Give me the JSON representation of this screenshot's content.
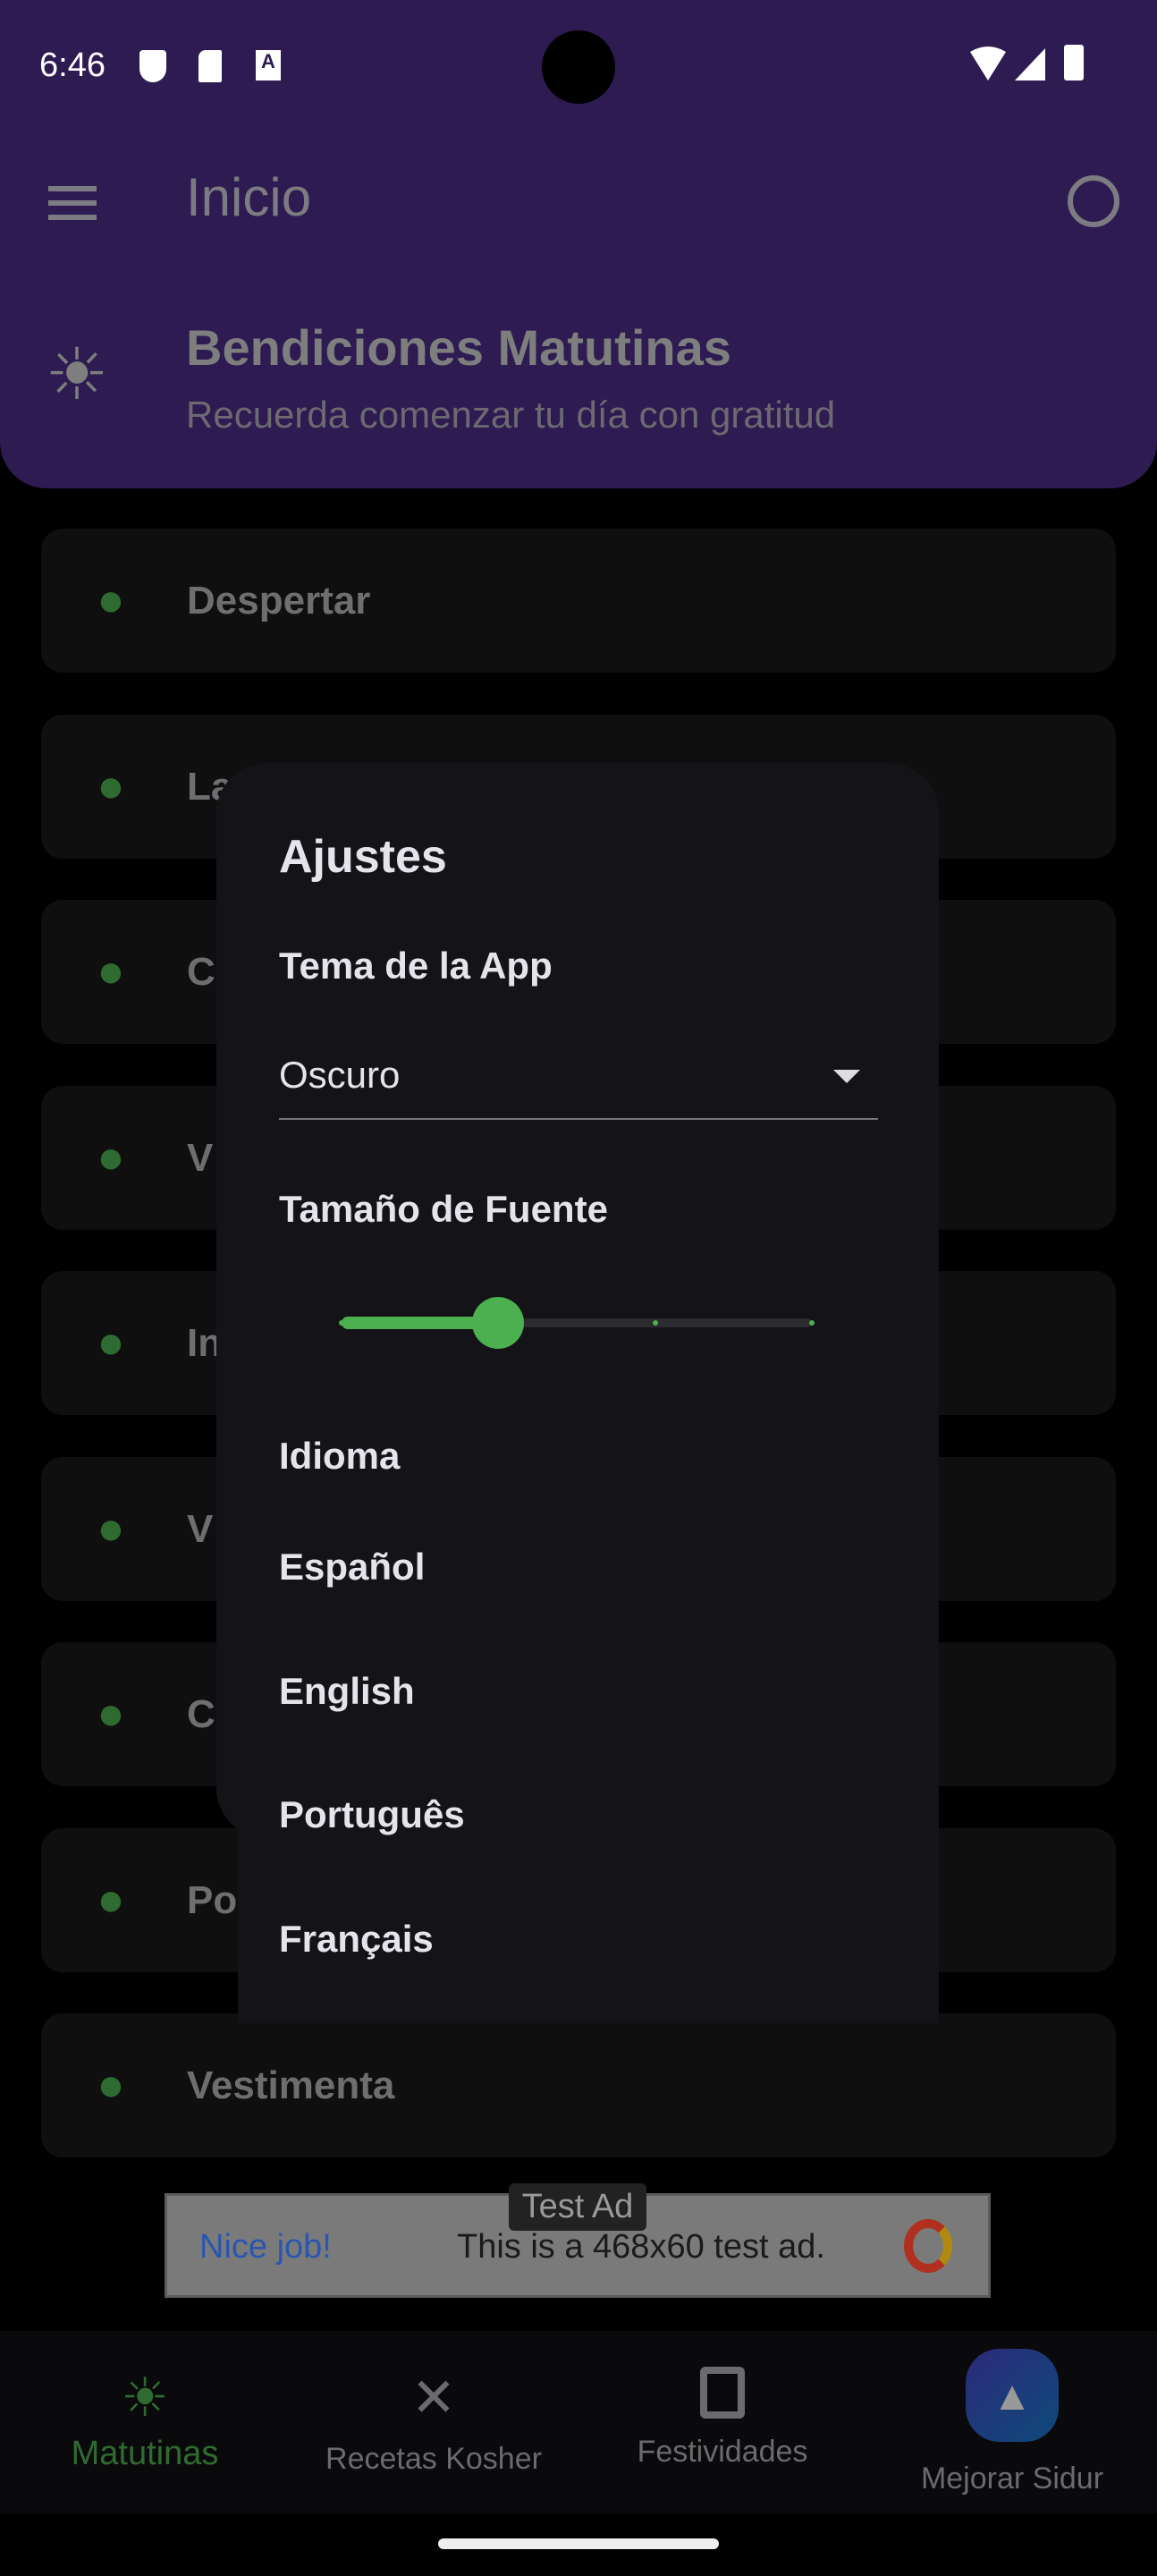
{
  "status": {
    "time": "6:46",
    "icons": [
      "shield-play-icon",
      "sd-card-icon",
      "a-badge-icon",
      "wifi-icon",
      "signal-icon",
      "battery-icon"
    ]
  },
  "appbar": {
    "title": "Inicio",
    "menu_icon": "hamburger-icon",
    "profile_icon": "account-circle-icon"
  },
  "header": {
    "icon": "sunrise-icon",
    "title": "Bendiciones Matutinas",
    "subtitle": "Recuerda comenzar tu día con gratitud"
  },
  "list": [
    {
      "label": "Despertar",
      "icon": "alarm-icon"
    },
    {
      "label": "Lav",
      "icon": "hand-wash-icon"
    },
    {
      "label": "C",
      "icon": "heart-icon"
    },
    {
      "label": "V",
      "icon": "bandage-icon"
    },
    {
      "label": "In",
      "icon": "head-gear-icon"
    },
    {
      "label": "V",
      "icon": "eye-icon"
    },
    {
      "label": "C",
      "icon": "walk-icon"
    },
    {
      "label": "Po",
      "icon": "person-icon"
    },
    {
      "label": "Vestimenta",
      "icon": "hanger-icon"
    }
  ],
  "dialog": {
    "title": "Ajustes",
    "theme_label": "Tema de la App",
    "theme_value": "Oscuro",
    "font_label": "Tamaño de Fuente",
    "font_slider": {
      "stops": 4,
      "value_index": 1,
      "fraction": 0.333
    },
    "language_label": "Idioma",
    "languages": [
      "Español",
      "English",
      "Português",
      "Français"
    ]
  },
  "ad": {
    "badge": "Test Ad",
    "headline": "Nice job!",
    "text": "This is a 468x60 test ad."
  },
  "nav": [
    {
      "label": "Matutinas",
      "icon": "sunrise-icon",
      "active": true
    },
    {
      "label": "Recetas Kosher",
      "icon": "utensils-icon"
    },
    {
      "label": "Festividades",
      "icon": "calendar-icon"
    },
    {
      "label": "Mejorar Sidur",
      "icon": "mountain-icon"
    }
  ],
  "colors": {
    "appbar": "#2e1b52",
    "accent": "#4caf50",
    "dialog": "#141318"
  }
}
